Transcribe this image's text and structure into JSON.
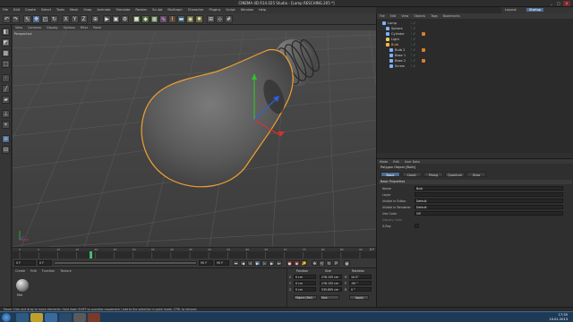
{
  "window": {
    "title": "CINEMA 4D R14.025 Studio - [Lamp RESCHING.205 *]",
    "minimize": "_",
    "maximize": "□",
    "close": "x"
  },
  "menu": [
    "File",
    "Edit",
    "Create",
    "Select",
    "Tools",
    "Mesh",
    "Snap",
    "Animate",
    "Simulate",
    "Render",
    "Sculpt",
    "MoGraph",
    "Character",
    "Plugins",
    "Script",
    "Window",
    "Help"
  ],
  "layout": {
    "label": "Layout:",
    "value": "Startup"
  },
  "viewport": {
    "menu": [
      "View",
      "Cameras",
      "Display",
      "Options",
      "Filter",
      "Panel"
    ],
    "label": "Perspective",
    "colors": {
      "bg": "#4a4a4a",
      "grid": "#5a5a5a",
      "outline": "#f0a030"
    }
  },
  "timeline": {
    "ticks": [
      "0",
      "5",
      "10",
      "15",
      "20",
      "25",
      "30",
      "35",
      "40",
      "45",
      "50",
      "55",
      "60",
      "65",
      "70",
      "75",
      "80",
      "85",
      "90"
    ],
    "frame_indicator": "0 F"
  },
  "transport": {
    "start": "0 F",
    "current": "0 F",
    "end": "90 F",
    "end2": "90 F"
  },
  "material_manager": {
    "menu": [
      "Create",
      "Edit",
      "Function",
      "Texture"
    ],
    "material_name": "Mat"
  },
  "coordinates": {
    "headers": [
      "Position",
      "Size",
      "Rotation"
    ],
    "rows": [
      {
        "axis": "X",
        "pos": "0 cm",
        "size": "278.155 cm",
        "raxis": "H",
        "rot": "10.5°"
      },
      {
        "axis": "Y",
        "pos": "0 cm",
        "size": "278.155 cm",
        "raxis": "P",
        "rot": "-90 °"
      },
      {
        "axis": "Z",
        "pos": "0 cm",
        "size": "535.895 cm",
        "raxis": "B",
        "rot": "0 °"
      }
    ],
    "mode_object": "Object (Rel)",
    "mode_size": "Size",
    "apply": "Apply"
  },
  "object_manager": {
    "menu": [
      "File",
      "Edit",
      "View",
      "Objects",
      "Tags",
      "Bookmarks"
    ],
    "items": [
      {
        "name": "Lamp",
        "selected": false,
        "indent": 0
      },
      {
        "name": "Sphere",
        "selected": false,
        "indent": 1
      },
      {
        "name": "Cylinder",
        "selected": false,
        "indent": 1
      },
      {
        "name": "Light",
        "selected": false,
        "indent": 1
      },
      {
        "name": "Bulb",
        "selected": true,
        "indent": 1
      },
      {
        "name": "Bulb 2",
        "selected": false,
        "indent": 2
      },
      {
        "name": "Base 1",
        "selected": false,
        "indent": 2
      },
      {
        "name": "Base 2",
        "selected": false,
        "indent": 2
      },
      {
        "name": "Screw",
        "selected": false,
        "indent": 2
      }
    ]
  },
  "attributes": {
    "menu": [
      "Mode",
      "Edit",
      "User Data"
    ],
    "title": "Polygon Object [Bulb]",
    "tabs": [
      "Basic",
      "Coord.",
      "Phong",
      "Quantum",
      "Glow"
    ],
    "section": "Basic Properties",
    "rows": [
      {
        "label": "Name",
        "value": "Bulb"
      },
      {
        "label": "Layer",
        "value": ""
      },
      {
        "label": "Visible in Editor",
        "value": "Default"
      },
      {
        "label": "Visible in Renderer",
        "value": "Default"
      },
      {
        "label": "Use Color",
        "value": "Off"
      },
      {
        "label": "Display Color",
        "value": ""
      },
      {
        "label": "X-Ray",
        "value": ""
      }
    ]
  },
  "status": "Move: Click and drag to move elements. Hold down SHIFT to quantize movement / add to the selection in point mode, CTRL to remove.",
  "clock": {
    "time": "17:35",
    "date": "10.01.2013"
  }
}
